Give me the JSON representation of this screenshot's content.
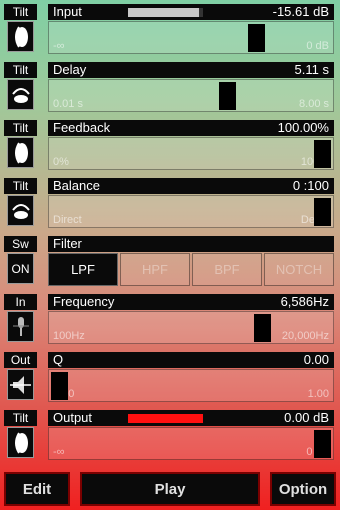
{
  "rows": [
    {
      "tag": "Tilt",
      "name": "Input",
      "value": "-15.61 dB",
      "min": "-∞",
      "max": "0 dB",
      "level": 0.75,
      "meter_level": 0.95,
      "meter_color": "#c8c8c8",
      "icon": "tilt-icon"
    },
    {
      "tag": "Tilt",
      "name": "Delay",
      "value": "5.11 s",
      "min": "0.01 s",
      "max": "8.00 s",
      "level": 0.64,
      "icon": "tilt-arc-icon"
    },
    {
      "tag": "Tilt",
      "name": "Feedback",
      "value": "100.00%",
      "min": "0%",
      "max": "100%",
      "level": 1.0,
      "icon": "tilt-icon"
    },
    {
      "tag": "Tilt",
      "name": "Balance",
      "value": "0 :100",
      "min": "Direct",
      "max": "Delay",
      "level": 1.0,
      "icon": "tilt-arc-icon"
    },
    {
      "tag": "In",
      "name": "Frequency",
      "value": "6,586Hz",
      "min": "100Hz",
      "max": "20,000Hz",
      "level": 0.77,
      "icon": "microphone-icon"
    },
    {
      "tag": "Out",
      "name": "Q",
      "value": "0.00",
      "min": "0.00",
      "max": "1.00",
      "level": 0.0,
      "icon": "speaker-icon"
    },
    {
      "tag": "Tilt",
      "name": "Output",
      "value": "0.00 dB",
      "min": "-∞",
      "max": "0 dB",
      "level": 1.0,
      "meter_level": 1.0,
      "meter_color": "#ff1010",
      "icon": "tilt-icon"
    }
  ],
  "filter": {
    "tag": "Sw",
    "switch_label": "ON",
    "name": "Filter",
    "options": [
      "LPF",
      "HPF",
      "BPF",
      "NOTCH"
    ],
    "selected": 0
  },
  "buttons": {
    "edit": "Edit",
    "play": "Play",
    "option": "Option"
  },
  "colors": {
    "accent_border": "#7a0000"
  }
}
